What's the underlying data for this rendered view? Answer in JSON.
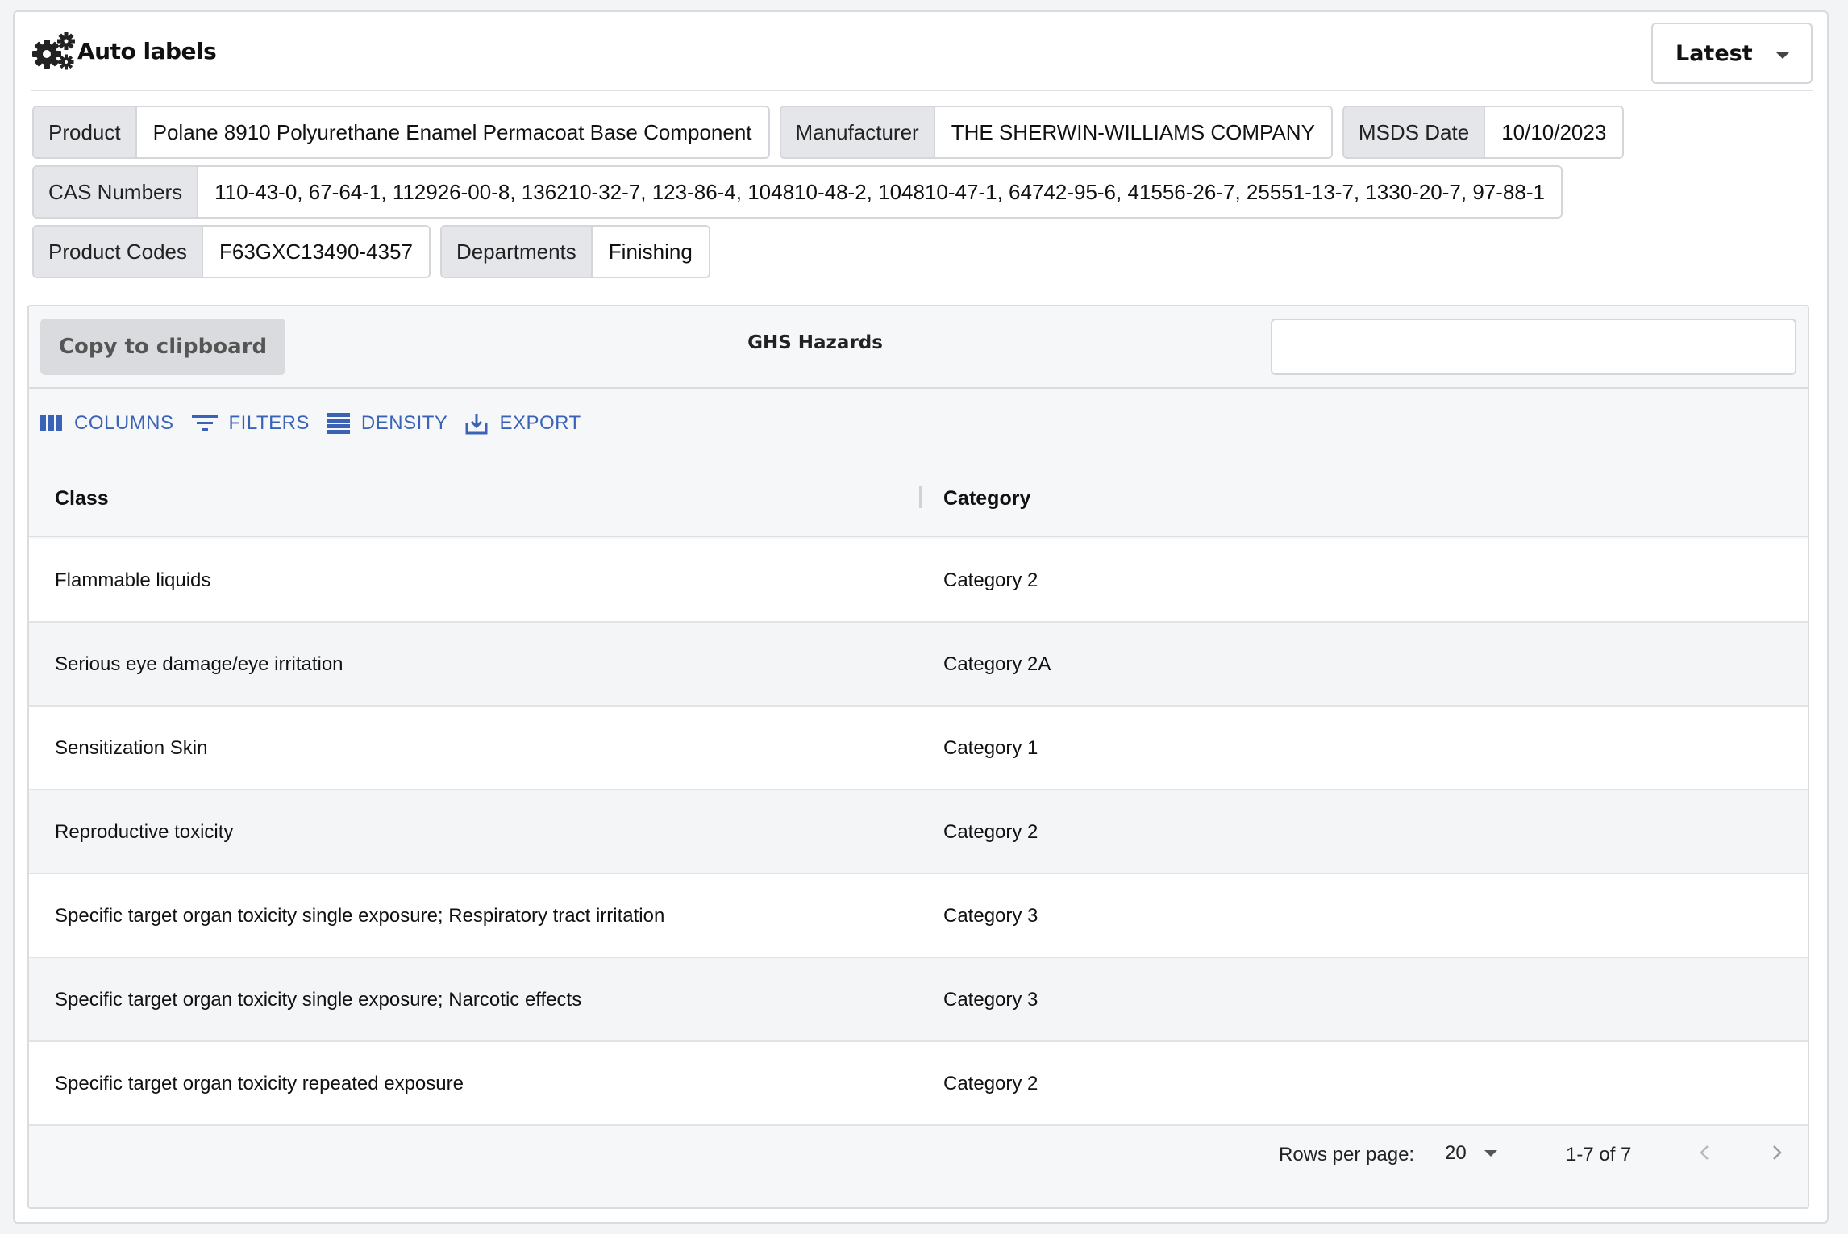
{
  "header": {
    "title": "Auto labels",
    "version_select": "Latest"
  },
  "fields": {
    "product": {
      "label": "Product",
      "value": "Polane 8910 Polyurethane Enamel Permacoat Base Component"
    },
    "manufacturer": {
      "label": "Manufacturer",
      "value": "THE SHERWIN-WILLIAMS COMPANY"
    },
    "msds_date": {
      "label": "MSDS Date",
      "value": "10/10/2023"
    },
    "cas_numbers": {
      "label": "CAS Numbers",
      "value": "110-43-0, 67-64-1, 112926-00-8, 136210-32-7, 123-86-4, 104810-48-2, 104810-47-1, 64742-95-6, 41556-26-7, 25551-13-7, 1330-20-7, 97-88-1"
    },
    "product_codes": {
      "label": "Product Codes",
      "value": "F63GXC13490-4357"
    },
    "departments": {
      "label": "Departments",
      "value": "Finishing"
    }
  },
  "grid": {
    "copy_label": "Copy to clipboard",
    "title": "GHS Hazards",
    "search_value": "",
    "toolbar": {
      "columns": "COLUMNS",
      "filters": "FILTERS",
      "density": "DENSITY",
      "export": "EXPORT"
    },
    "columns": [
      "Class",
      "Category"
    ],
    "rows": [
      [
        "Flammable liquids",
        "Category 2"
      ],
      [
        "Serious eye damage/eye irritation",
        "Category 2A"
      ],
      [
        "Sensitization Skin",
        "Category 1"
      ],
      [
        "Reproductive toxicity",
        "Category 2"
      ],
      [
        "Specific target organ toxicity single exposure; Respiratory tract irritation",
        "Category 3"
      ],
      [
        "Specific target organ toxicity single exposure; Narcotic effects",
        "Category 3"
      ],
      [
        "Specific target organ toxicity repeated exposure",
        "Category 2"
      ]
    ],
    "footer": {
      "rows_per_page_label": "Rows per page:",
      "rows_per_page": "20",
      "range": "1-7 of 7"
    }
  },
  "colors": {
    "accent": "#3a63b8",
    "label_bg": "#e4e6e9",
    "panel_bg": "#f6f7f9"
  },
  "icons": {
    "header": "gears-icon",
    "columns": "columns-icon",
    "filters": "filter-icon",
    "density": "density-icon",
    "export": "download-icon",
    "prev": "chevron-left-icon",
    "next": "chevron-right-icon"
  }
}
